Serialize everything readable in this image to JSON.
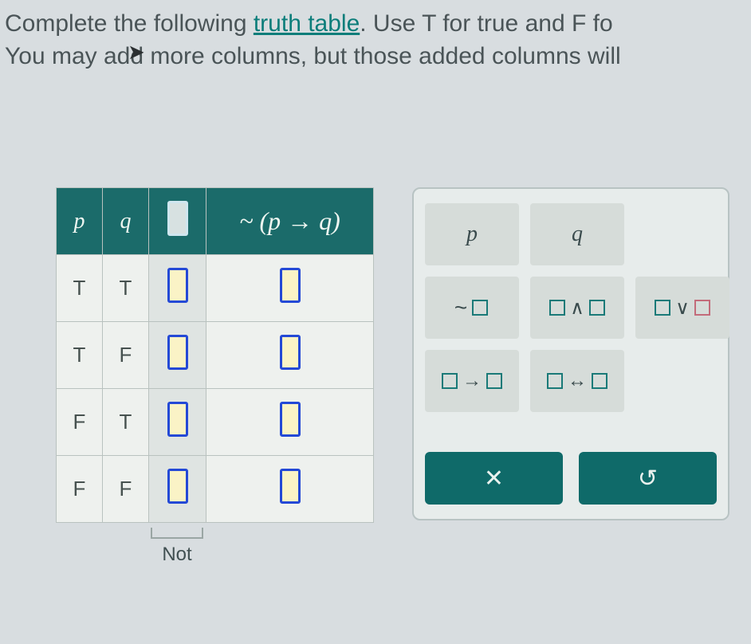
{
  "instructions": {
    "line1_pre": "Complete the following ",
    "line1_link": "truth table",
    "line1_post": ". Use T for true and F fo",
    "line2": "You may add more columns, but those added columns will "
  },
  "table": {
    "headers": {
      "p": "p",
      "q": "q",
      "expr": "~ (p → q)"
    },
    "rows": [
      {
        "p": "T",
        "q": "T"
      },
      {
        "p": "T",
        "q": "F"
      },
      {
        "p": "F",
        "q": "T"
      },
      {
        "p": "F",
        "q": "F"
      }
    ],
    "not_label": "Not"
  },
  "palette": {
    "p": "p",
    "q": "q",
    "not": "~",
    "and": "∧",
    "or": "∨",
    "cond": "→",
    "bicond": "↔",
    "clear": "✕",
    "reset": "↺"
  }
}
